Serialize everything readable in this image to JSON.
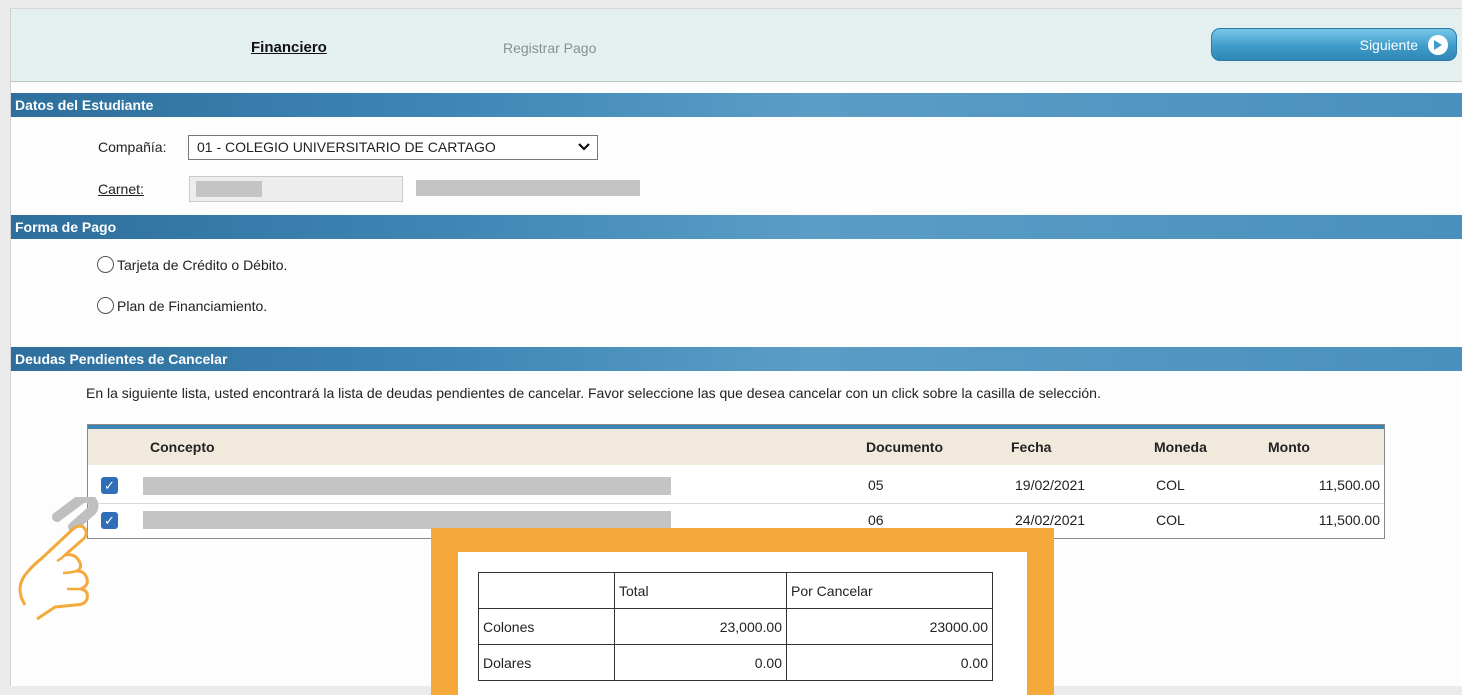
{
  "header": {
    "tabs": [
      {
        "label": "Financiero",
        "active": true
      },
      {
        "label": "Registrar Pago",
        "active": false
      }
    ],
    "next_button": "Siguiente"
  },
  "student": {
    "section_title": "Datos del Estudiante",
    "company_label": "Compañía:",
    "company_value": "01 - COLEGIO UNIVERSITARIO DE CARTAGO",
    "carnet_label": "Carnet:"
  },
  "payment": {
    "section_title": "Forma de Pago",
    "options": [
      "Tarjeta de Crédito o Débito.",
      "Plan de Financiamiento."
    ]
  },
  "debts": {
    "section_title": "Deudas Pendientes de Cancelar",
    "instructions": "En la siguiente lista, usted encontrará la lista de deudas pendientes de cancelar. Favor seleccione las que desea cancelar con un click sobre la casilla de selección.",
    "columns": [
      "Concepto",
      "Documento",
      "Fecha",
      "Moneda",
      "Monto"
    ],
    "rows": [
      {
        "documento": "05",
        "fecha": "19/02/2021",
        "moneda": "COL",
        "monto": "11,500.00",
        "checked": true
      },
      {
        "documento": "06",
        "fecha": "24/02/2021",
        "moneda": "COL",
        "monto": "11,500.00",
        "checked": true
      }
    ]
  },
  "totals": {
    "headers": [
      "Total",
      "Por Cancelar"
    ],
    "rows": [
      {
        "label": "Colones",
        "total": "23,000.00",
        "por_cancelar": "23000.00"
      },
      {
        "label": "Dolares",
        "total": "0.00",
        "por_cancelar": "0.00"
      }
    ]
  },
  "colors": {
    "section_bar": "#3f86b5",
    "highlight": "#f4a93a",
    "checkbox": "#2e6fb8"
  }
}
